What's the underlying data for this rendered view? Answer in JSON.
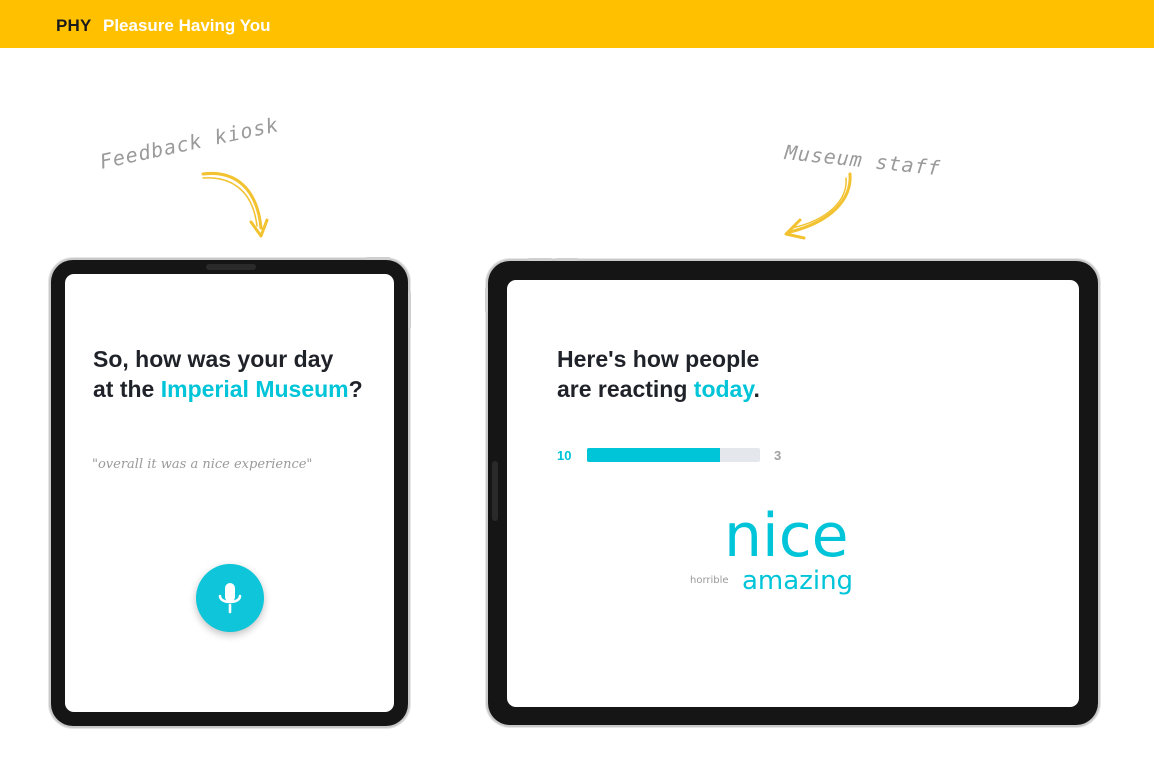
{
  "header": {
    "brand": "PHY",
    "tagline": "Pleasure Having You"
  },
  "annotations": {
    "left": "Feedback kiosk",
    "right": "Museum staff"
  },
  "kiosk": {
    "question_line1": "So, how was your day",
    "question_line2_prefix": "at the ",
    "question_highlight": "Imperial Museum",
    "question_suffix": "?",
    "quote": "\"overall it was a nice experience\"",
    "mic_icon": "microphone-icon"
  },
  "staff": {
    "title_line1": "Here's how people",
    "title_line2_prefix": "are reacting ",
    "title_highlight": "today",
    "title_suffix": ".",
    "positive_count": "10",
    "negative_count": "3",
    "positive_fraction": 0.769,
    "word_cloud": [
      {
        "text": "nice"
      },
      {
        "text": "amazing"
      },
      {
        "text": "horrible"
      }
    ]
  },
  "colors": {
    "header_bg": "#ffc000",
    "accent": "#00c4d8",
    "text_dark": "#1f2329"
  }
}
